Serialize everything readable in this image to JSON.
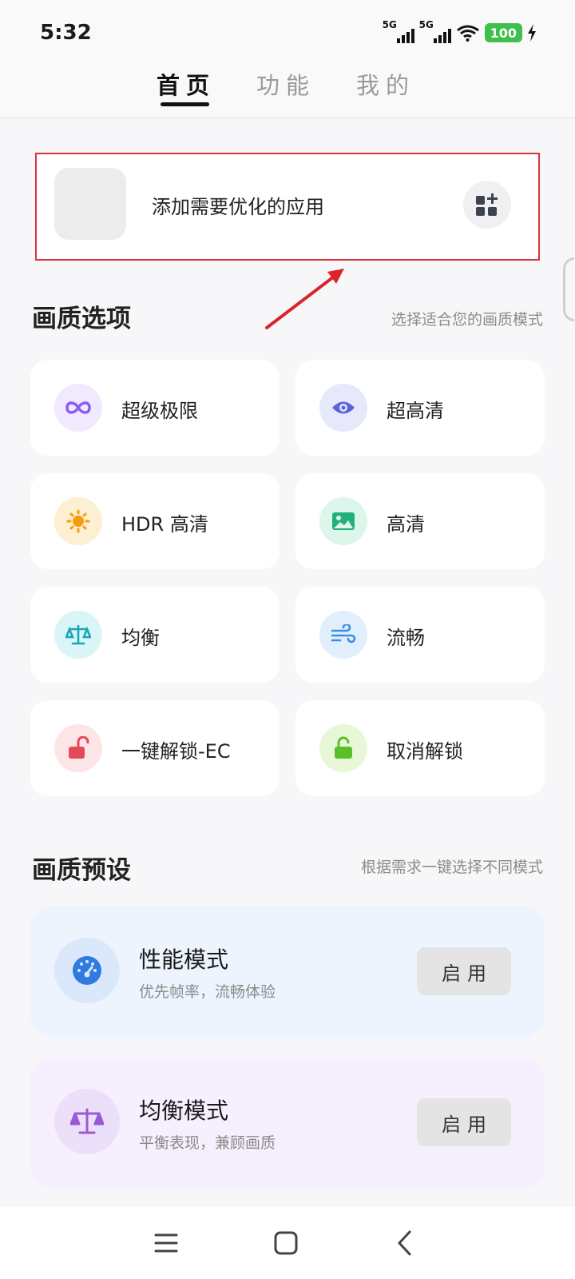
{
  "status_bar": {
    "time": "5:32",
    "signal1_label": "5G",
    "signal2_label": "5G",
    "battery": "100"
  },
  "tabs": [
    {
      "label": "首页",
      "active": true
    },
    {
      "label": "功能",
      "active": false
    },
    {
      "label": "我的",
      "active": false
    }
  ],
  "add_app": {
    "label": "添加需要优化的应用",
    "icon": "grid-plus-icon"
  },
  "quality_options": {
    "title": "画质选项",
    "subtitle": "选择适合您的画质模式",
    "items": [
      {
        "label": "超级极限",
        "icon": "infinity-icon",
        "color": "#8b5cf6",
        "bg": "#f1eaff"
      },
      {
        "label": "超高清",
        "icon": "eye-icon",
        "color": "#5b63d9",
        "bg": "#e6e8fb"
      },
      {
        "label": "HDR 高清",
        "icon": "sun-icon",
        "color": "#f59e0b",
        "bg": "#fdf0d2"
      },
      {
        "label": "高清",
        "icon": "image-icon",
        "color": "#22b07a",
        "bg": "#ddf6ec"
      },
      {
        "label": "均衡",
        "icon": "balance-icon",
        "color": "#1ba6b8",
        "bg": "#daf5f8"
      },
      {
        "label": "流畅",
        "icon": "wind-icon",
        "color": "#3b8ee8",
        "bg": "#e1eefc"
      },
      {
        "label": "一键解锁-EC",
        "icon": "unlock-icon",
        "color": "#e24a5a",
        "bg": "#fde4e7"
      },
      {
        "label": "取消解锁",
        "icon": "unlock-icon",
        "color": "#5bbf2a",
        "bg": "#e8f8d6"
      }
    ]
  },
  "quality_presets": {
    "title": "画质预设",
    "subtitle": "根据需求一键选择不同模式",
    "items": [
      {
        "title": "性能模式",
        "subtitle": "优先帧率，流畅体验",
        "button": "启用",
        "icon": "speedometer-icon",
        "color": "#2f7be0"
      },
      {
        "title": "均衡模式",
        "subtitle": "平衡表现，兼顾画质",
        "button": "启用",
        "icon": "balance-icon",
        "color": "#9b59d6"
      }
    ]
  },
  "nav_bar": {
    "menu_icon": "menu-icon",
    "home_icon": "home-square-icon",
    "back_icon": "back-chevron-icon"
  }
}
